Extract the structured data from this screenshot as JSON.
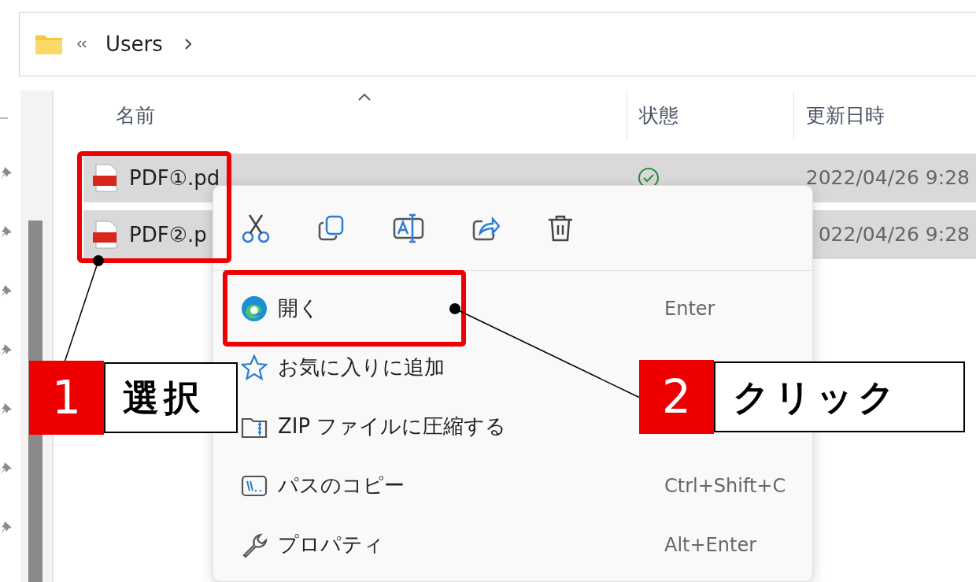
{
  "address_bar": {
    "path": "Users"
  },
  "columns": [
    "名前",
    "状態",
    "更新日時"
  ],
  "rows": [
    {
      "name": "PDF①.pd",
      "synced": true,
      "modified": "2022/04/26 9:28",
      "selected": true
    },
    {
      "name": "PDF②.p",
      "modified": "022/04/26 9:28",
      "selected": true
    }
  ],
  "context_menu": {
    "items": [
      {
        "label": "開く",
        "shortcut": "Enter"
      },
      {
        "label": "お気に入りに追加"
      },
      {
        "label": "ZIP ファイルに圧縮する"
      },
      {
        "label": "パスのコピー",
        "shortcut": "Ctrl+Shift+C"
      },
      {
        "label": "プロパティ",
        "shortcut": "Alt+Enter"
      }
    ]
  },
  "callouts": [
    {
      "number": "1",
      "label": "選択"
    },
    {
      "number": "2",
      "label": "クリック"
    }
  ]
}
